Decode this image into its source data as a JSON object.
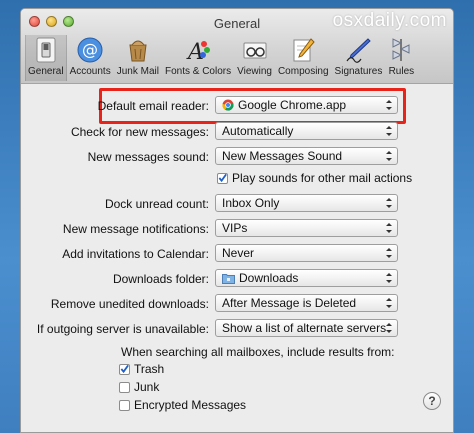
{
  "window": {
    "title": "General",
    "watermark": "osxdaily.com"
  },
  "toolbar": {
    "items": [
      {
        "label": "General",
        "icon": "light-switch-icon",
        "active": true
      },
      {
        "label": "Accounts",
        "icon": "at-sign-icon"
      },
      {
        "label": "Junk Mail",
        "icon": "trash-bag-icon"
      },
      {
        "label": "Fonts & Colors",
        "icon": "fonts-colors-icon"
      },
      {
        "label": "Viewing",
        "icon": "glasses-icon"
      },
      {
        "label": "Composing",
        "icon": "pencil-paper-icon"
      },
      {
        "label": "Signatures",
        "icon": "pen-signature-icon"
      },
      {
        "label": "Rules",
        "icon": "rules-icon"
      }
    ]
  },
  "settings": {
    "default_email_reader": {
      "label": "Default email reader:",
      "value": "Google Chrome.app",
      "icon": "chrome-icon"
    },
    "check_new_messages": {
      "label": "Check for new messages:",
      "value": "Automatically"
    },
    "new_messages_sound": {
      "label": "New messages sound:",
      "value": "New Messages Sound"
    },
    "play_sounds": {
      "label": "Play sounds for other mail actions",
      "checked": true
    },
    "dock_unread_count": {
      "label": "Dock unread count:",
      "value": "Inbox Only"
    },
    "new_message_notifications": {
      "label": "New message notifications:",
      "value": "VIPs"
    },
    "add_invitations": {
      "label": "Add invitations to Calendar:",
      "value": "Never"
    },
    "downloads_folder": {
      "label": "Downloads folder:",
      "value": "Downloads",
      "icon": "folder-icon"
    },
    "remove_unedited_downloads": {
      "label": "Remove unedited downloads:",
      "value": "After Message is Deleted"
    },
    "outgoing_server_unavailable": {
      "label": "If outgoing server is unavailable:",
      "value": "Show a list of alternate servers"
    }
  },
  "search": {
    "title": "When searching all mailboxes, include results from:",
    "options": [
      {
        "label": "Trash",
        "checked": true
      },
      {
        "label": "Junk",
        "checked": false
      },
      {
        "label": "Encrypted Messages",
        "checked": false
      }
    ]
  },
  "help": {
    "label": "?"
  },
  "colors": {
    "highlight": "#e8231a",
    "check": "#1f5fc7"
  }
}
